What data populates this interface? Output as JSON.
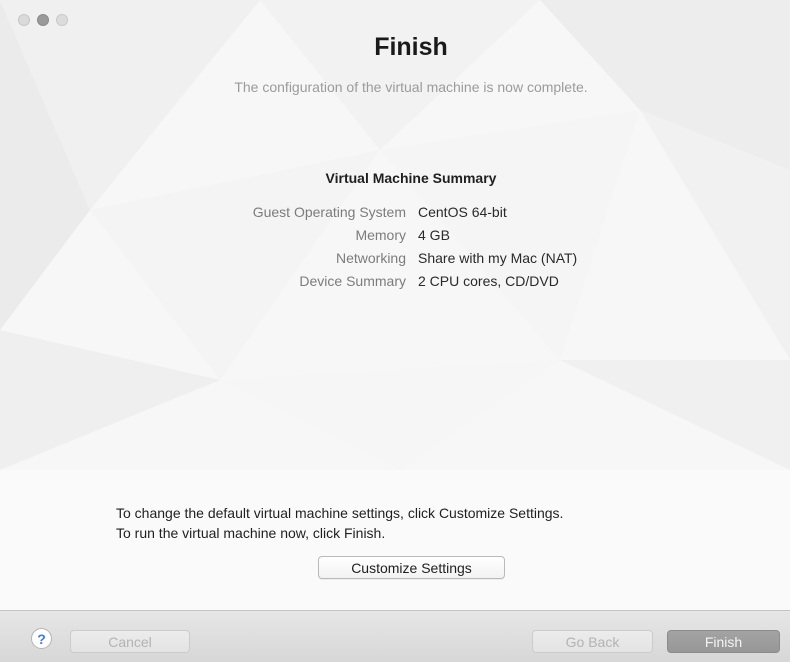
{
  "window": {
    "title": "Finish",
    "subtitle": "The configuration of the virtual machine is now complete."
  },
  "summary": {
    "title": "Virtual Machine Summary",
    "rows": [
      {
        "label": "Guest Operating System",
        "value": "CentOS 64-bit"
      },
      {
        "label": "Memory",
        "value": "4 GB"
      },
      {
        "label": "Networking",
        "value": "Share with my Mac (NAT)"
      },
      {
        "label": "Device Summary",
        "value": "2 CPU cores, CD/DVD"
      }
    ]
  },
  "instructions": {
    "line1": "To change the default virtual machine settings, click Customize Settings.",
    "line2": "To run the virtual machine now, click Finish."
  },
  "buttons": {
    "customize": "Customize Settings",
    "help": "?",
    "cancel": "Cancel",
    "go_back": "Go Back",
    "finish": "Finish"
  },
  "icons": {
    "help": "help-icon",
    "close": "close-icon",
    "minimize": "minimize-icon",
    "maximize": "maximize-icon"
  },
  "colors": {
    "help_accent": "#3d7be0",
    "finish_button": "#9d9d9d",
    "disabled_text": "#b3b3b3"
  }
}
